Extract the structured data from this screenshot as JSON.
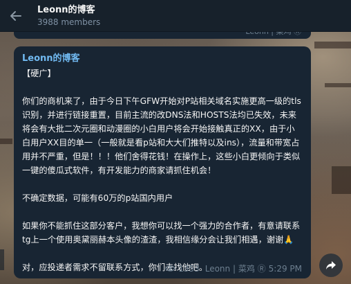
{
  "header": {
    "title": "Leonn的博客",
    "members": "3988 members"
  },
  "prev_message": {
    "meta": "Leonn | 菜鸡 Ⓡ"
  },
  "message": {
    "sender": "Leonn的博客",
    "text": "【硬广】\n\n你们的商机来了，由于今日下午GFW开始对P站相关域名实施更高一级的tls识别，并进行链接重置，目前主流的改DNS法和HOSTS法均已失效，未来将会有大批二次元圈和动漫圈的小白用户将会开始接触真正的XX，由于小白用户XX目的单一（一般就是看p站和大大们推特以及ins），流量和带宽占用并不严重，但是！！！他们舍得花钱！在操作上，这些小白更倾向于类似一键的傻瓜式软件，有开发能力的商家请抓住机会！\n\n不确定数据，可能有60万的p站国内用户\n\n如果你不能抓住这部分客户，我想你可以找一个强力的合作者，有意请联系tg上一个使用奥黛丽赫本头像的渣渣，我相信缘分会让我们相遇，谢谢🙏\n\n对，应投递者需求不留联系方式，你们去找他吧。",
    "views": "1353",
    "author": "Leonn | 菜鸡 Ⓡ",
    "time": "5:29 PM"
  },
  "icons": {
    "back": "arrow-left-icon",
    "views": "eye-icon",
    "share": "share-forward-icon"
  },
  "colors": {
    "header_bg": "#17212b",
    "bubble_bg": "#182533",
    "sender_color": "#71baf2",
    "text_color": "#f5f5f5",
    "meta_color": "#6d7f8f"
  }
}
